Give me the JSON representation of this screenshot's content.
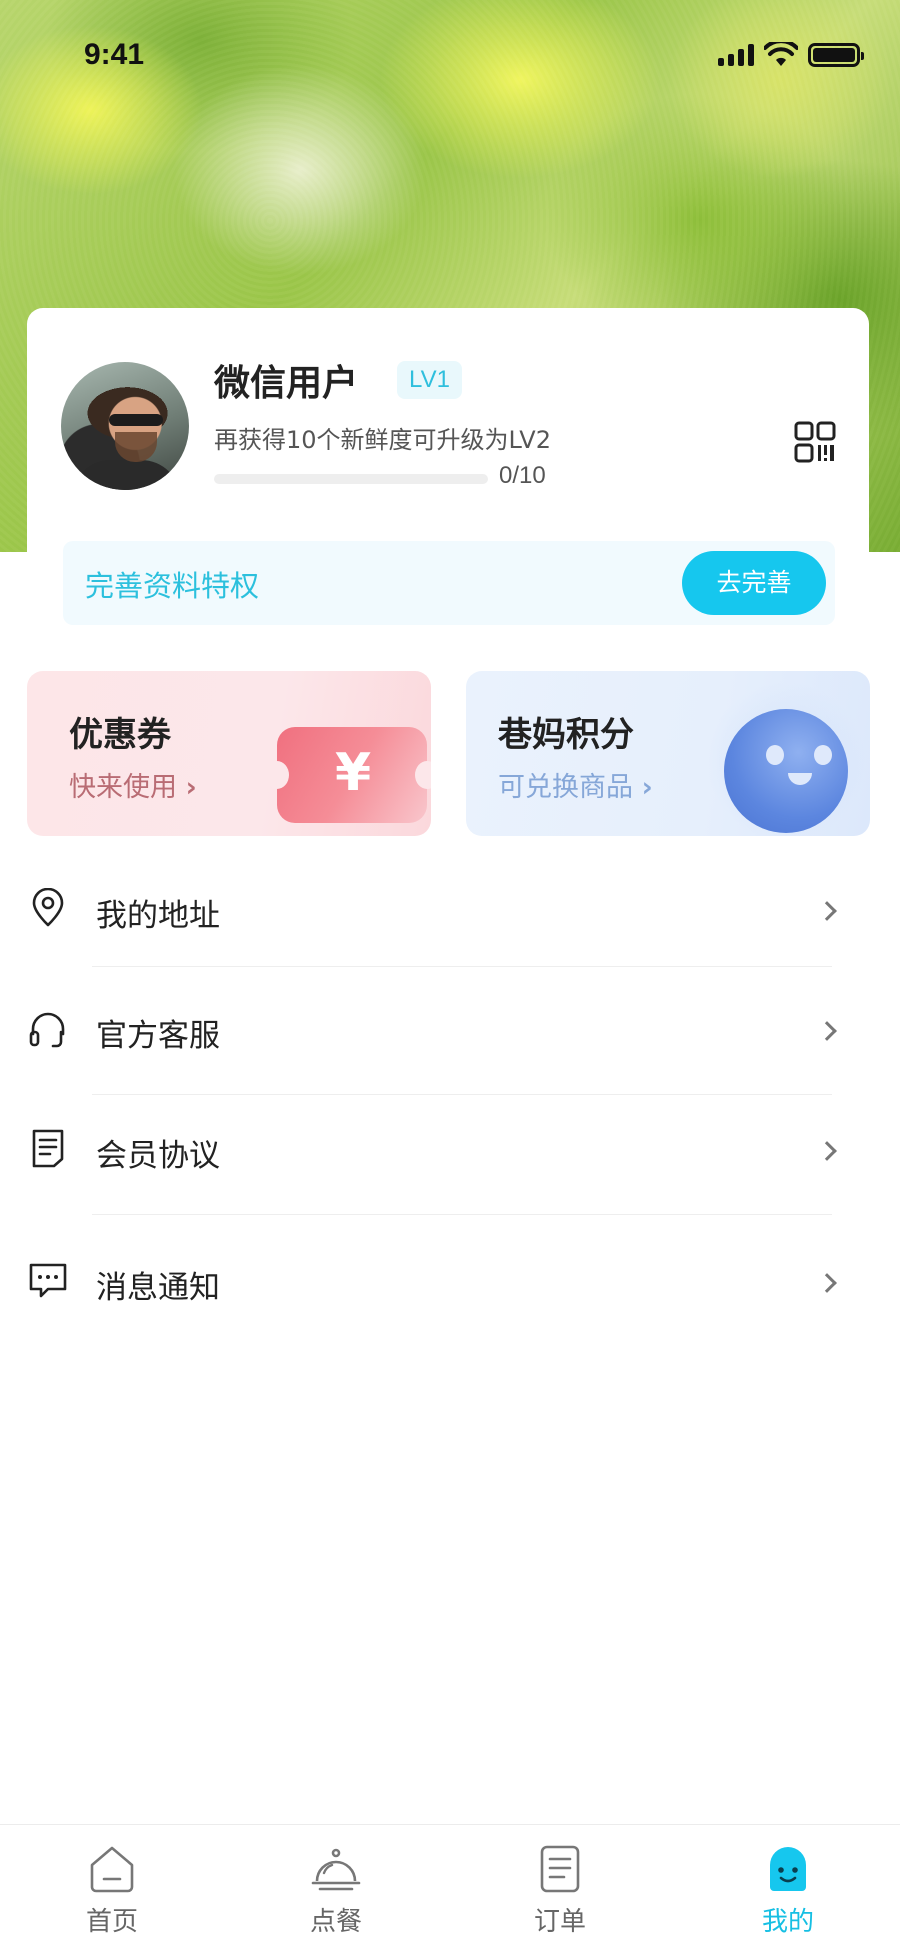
{
  "status_bar": {
    "time": "9:41"
  },
  "profile": {
    "name": "微信用户",
    "level": "LV1",
    "upgrade_tip": "再获得10个新鲜度可升级为LV2",
    "progress_text": "0/10",
    "progress_fraction": 0
  },
  "privilege": {
    "label": "完善资料特权",
    "button": "去完善"
  },
  "cards": {
    "coupon": {
      "title": "优惠券",
      "subtitle": "快来使用",
      "symbol": "¥"
    },
    "points": {
      "title": "巷妈积分",
      "subtitle": "可兑换商品"
    }
  },
  "menu": [
    {
      "label": "我的地址",
      "icon": "location-pin-icon"
    },
    {
      "label": "官方客服",
      "icon": "headset-icon"
    },
    {
      "label": "会员协议",
      "icon": "document-icon"
    },
    {
      "label": "消息通知",
      "icon": "message-icon"
    }
  ],
  "tabs": [
    {
      "label": "首页",
      "icon": "home-icon"
    },
    {
      "label": "点餐",
      "icon": "cloche-icon"
    },
    {
      "label": "订单",
      "icon": "order-list-icon"
    },
    {
      "label": "我的",
      "icon": "smiley-profile-icon",
      "active": true
    }
  ],
  "colors": {
    "accent": "#16c7ee",
    "accent_text": "#2cc0dd",
    "coupon_sub": "#b96c74",
    "points_sub": "#86a7d8"
  }
}
